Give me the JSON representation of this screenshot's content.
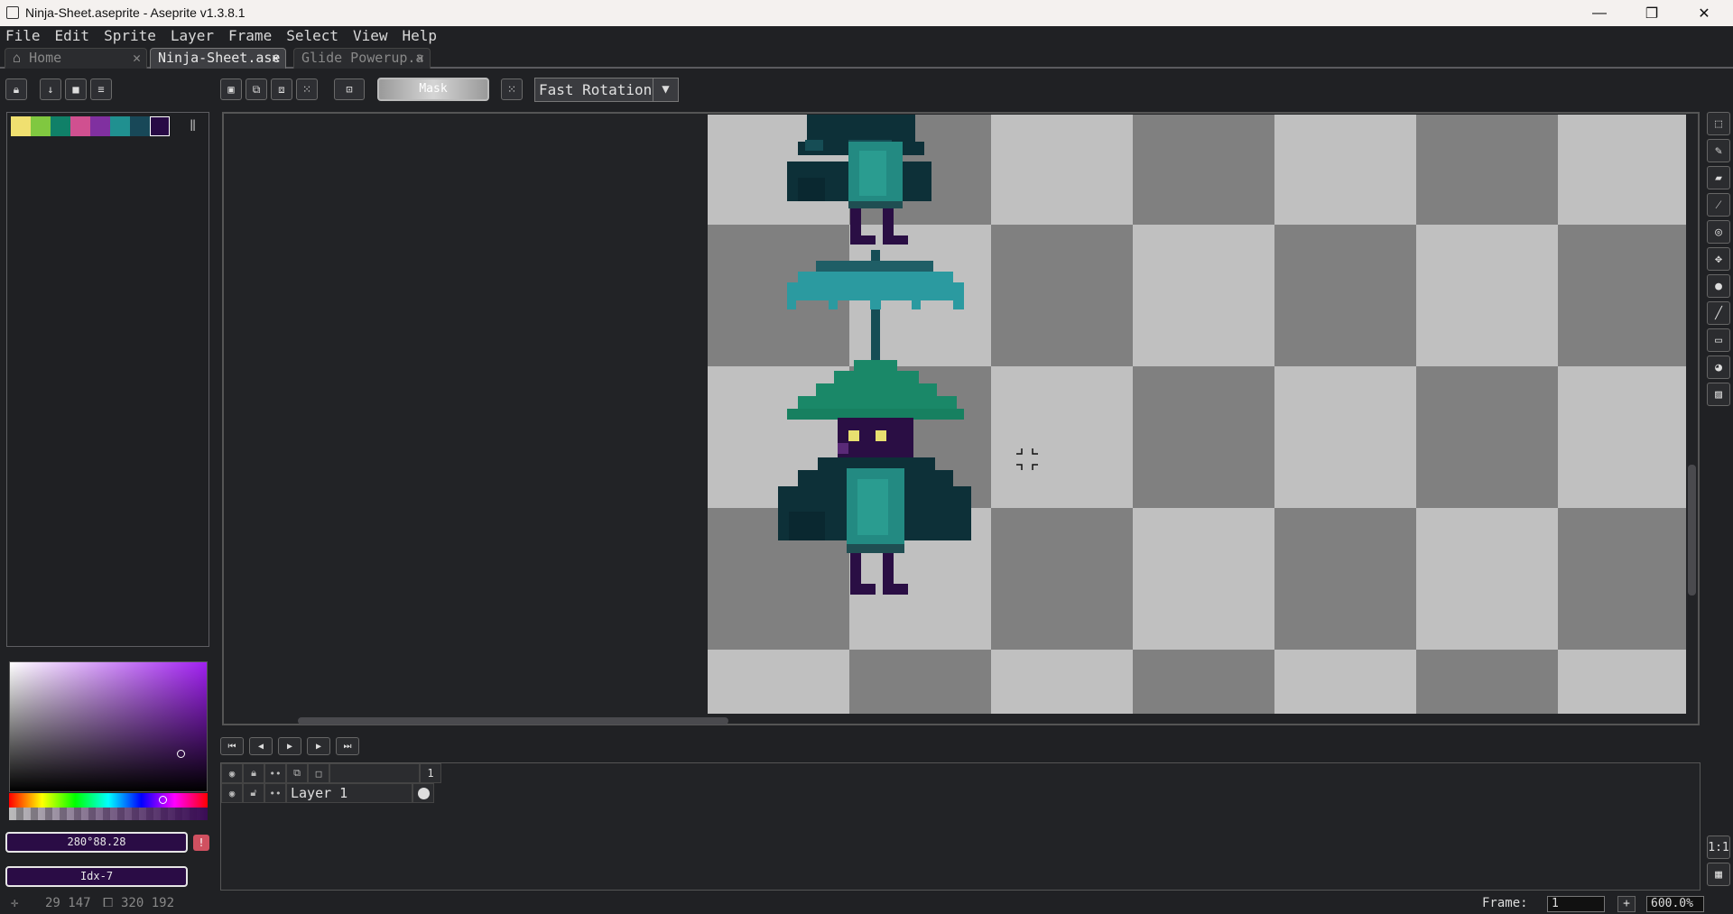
{
  "window": {
    "title": "Ninja-Sheet.aseprite - Aseprite v1.3.8.1",
    "minimize": "—",
    "restore": "❐",
    "close": "✕"
  },
  "menu": [
    "File",
    "Edit",
    "Sprite",
    "Layer",
    "Frame",
    "Select",
    "View",
    "Help"
  ],
  "tabs": [
    {
      "label": "Home",
      "icon": "home-icon",
      "active": false
    },
    {
      "label": "Ninja-Sheet.ase",
      "active": true
    },
    {
      "label": "Glide Powerup.a",
      "active": false
    }
  ],
  "toolbar": {
    "mask_label": "Mask",
    "rotation_select": "Fast Rotation"
  },
  "palette": {
    "colors": [
      "#f0e070",
      "#80c840",
      "#108068",
      "#d05090",
      "#8030a0",
      "#209090",
      "#184858",
      "#280a45"
    ]
  },
  "color": {
    "hsv_value": "280°88.28",
    "index_value": "Idx-7",
    "accent": "#2a0c45"
  },
  "canvas": {
    "checker_light": "#c0c0c0",
    "checker_dark": "#808080",
    "zoom": "600.0%"
  },
  "timeline": {
    "layer_name": "Layer 1",
    "frame_header": "1"
  },
  "status": {
    "cursor_pos": "29 147",
    "sprite_size": "320 192",
    "frame_label": "Frame:",
    "frame_value": "1",
    "zoom_value": "600.0%"
  }
}
